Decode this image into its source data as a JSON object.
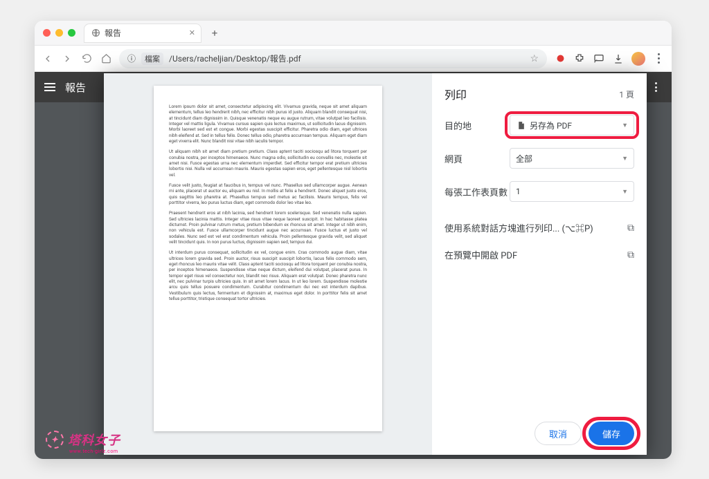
{
  "tab": {
    "title": "報告"
  },
  "url": {
    "scheme_badge": "檔案",
    "path": "/Users/racheljian/Desktop/報告.pdf"
  },
  "pdfviewer": {
    "title": "報告"
  },
  "print": {
    "title": "列印",
    "page_count": "1 頁",
    "destination_label": "目的地",
    "destination_value": "另存為 PDF",
    "pages_label": "網頁",
    "pages_value": "全部",
    "sheets_label": "每張工作表頁數",
    "sheets_value": "1",
    "system_dialog": "使用系統對話方塊進行列印... (⌥⌘P)",
    "open_preview": "在預覽中開啟 PDF",
    "cancel": "取消",
    "save": "儲存"
  },
  "lorem": {
    "p1": "Lorem ipsum dolor sit amet, consectetur adipiscing elit. Vivamus gravida, neque sit amet aliquam elementum, tellus leo hendrerit nibh, nec efficitur nibh purus id justo. Aliquam blandit consequat nisi, at tincidunt diam dignissim in. Quisque venenatis neque eu augue rutrum, vitae volutpat leo facilisis. Integer vel mattis ligula. Vivamus cursus sapien quis lectus maximus, ut sollicitudin lacus dignissim. Morbi laoreet sed est et congue. Morbi egestas suscipit efficitur. Pharetra odio diam, eget ultrices nibh eleifend at. Sed in tellus felis. Donec tellus odio, pharetra accumsan tempus. Aliquam eget diam eget viverra elit. Nunc blandit nisi vitae nibh iaculis tempor.",
    "p2": "Ut aliquam nibh sit amet diam pretium pretium. Class aptent taciti sociosqu ad litora torquent per conubia nostra, per inceptos himenaeos. Nunc magna odio, sollicitudin eu convallis nec, molestie sit amet nisi. Fusce egestas urna nec elementum imperdiet. Sed efficitur tempor erat pretium ultricies lobortis nisi. Nulla vel accumsan mauris. Mauris egestas sapien eros, eget pellentesque nisl lobortis vel.",
    "p3": "Fusce velit justo, feugiat at faucibus in, tempus vel nunc. Phasellus sed ullamcorper augue. Aenean mi ante, placerat ut auctor eu, aliquam eu nisl. In mollis at felis a hendrerit. Donec aliquet justo eros, quis sagittis leo pharetra at. Phasellus tempus sed metus ac facilisis. Mauris tempus, felis vel porttitor viverra, leo purus luctus diam, eget commodo dolor leo vitae leo.",
    "p4": "Praesent hendrerit eros at nibh lacinia, sed hendrerit lorem scelerisque. Sed venenatis nulla sapien. Sed ultricies lacinia mattis. Integer vitae risus vitae neque laoreet suscipit. In hac habitasse platea dictumst. Proin pulvinar rutrum metus, pretium bibendum ex rhoncus sit amet. Integer ut nibh enim, non vehicula est. Fusce ullamcorper tincidunt augue nec accumsan. Fusce luctus et justo vel sodales. Nunc sed est vel erat condimentum vehicula. Proin pellentesque gravida velit, sed aliquet velit tincidunt quis. In non purus luctus, dignissim sapien sed, tempus dui.",
    "p5": "Ut interdum purus consequat, sollicitudin ex vel, congue enim. Cras commodo augue diam, vitae ultrices lorem gravida sed. Proin auctor, risus suscipit suscipit lobortis, lacus felis commodo sem, eget rhoncus leo mauris vitae velit. Class aptent taciti sociosqu ad litora torquent per conubia nostra, per inceptos himenaeos. Suspendisse vitae neque dictum, eleifend dui volutpat, placerat purus. In tempor eget risus vel consectetur non, blandit nec risus. Aliquam erat volutpat. Donec pharetra nunc elit, nec pulvinar turpis ultricies quis. In sit amet lorem lacus. In ut leo lorem. Suspendisse molestie arcu quis tellus posuere condimentum. Curabitur condimentum dui nec est interdum dapibus. Vestibulum quis lectus, fermentum et dignissim at, maximus eget dolor. In porttitor felis sit amet tellus porttitor, tristique consequat tortor ultricies."
  },
  "bg_text": "Ut interdum purus consequat, sollicitudin ex vel, congue enim. Cras commodo augue diam, vitae ultrices lorem gravida sed. Proin auctor, risus suscipit suscipit lobortis, lacus felis commodo sem,",
  "watermark": {
    "name": "塔科女子",
    "url": "www.tech-girlz.com"
  }
}
